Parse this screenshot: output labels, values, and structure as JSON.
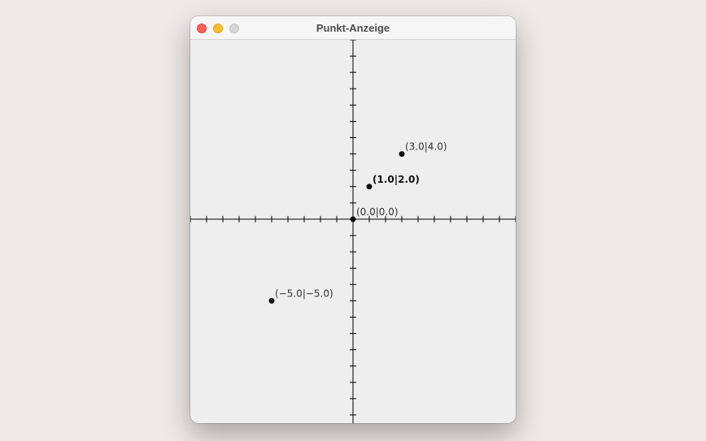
{
  "window": {
    "title": "Punkt-Anzeige"
  },
  "colors": {
    "axis": "#000000",
    "point": "#111111",
    "label": "#333333",
    "canvas": "#eeeeee"
  },
  "chart_data": {
    "type": "scatter",
    "title": "",
    "xlabel": "",
    "ylabel": "",
    "xlim": [
      -10,
      10
    ],
    "ylim": [
      -12.5,
      11
    ],
    "tick_step": 1,
    "grid": false,
    "points": [
      {
        "x": 0.0,
        "y": 0.0,
        "label": "(0.0|0.0)",
        "emphasis": false
      },
      {
        "x": 1.0,
        "y": 2.0,
        "label": "(1.0|2.0)",
        "emphasis": true
      },
      {
        "x": 3.0,
        "y": 4.0,
        "label": "(3.0|4.0)",
        "emphasis": false
      },
      {
        "x": -5.0,
        "y": -5.0,
        "label": "(−5.0|−5.0)",
        "emphasis": false
      }
    ]
  }
}
